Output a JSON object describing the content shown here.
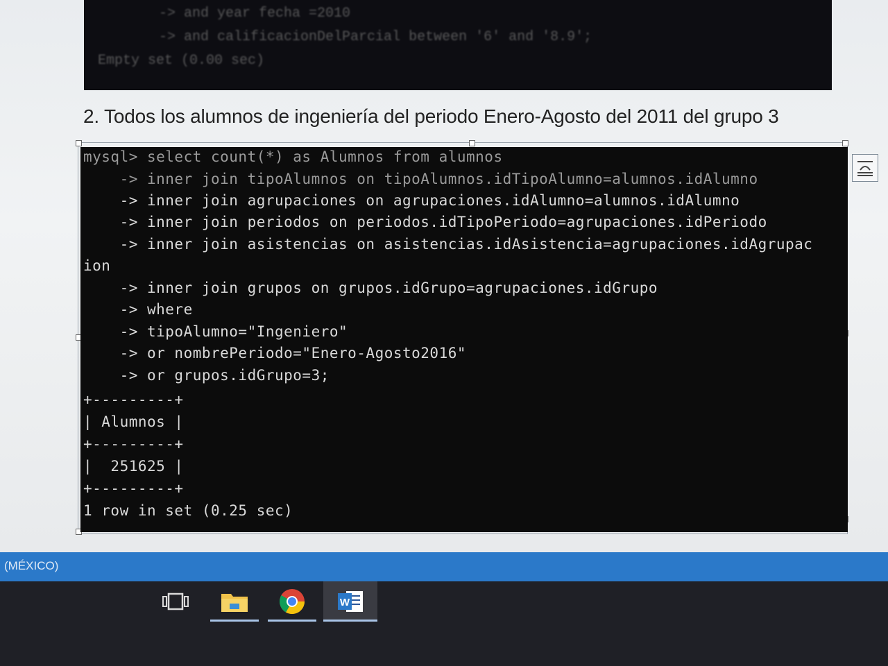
{
  "previous_terminal": {
    "lines": [
      "    -> and year fecha =2010",
      "    -> and calificacionDelParcial between '6' and '8.9';",
      "Empty set (0.00 sec)"
    ]
  },
  "heading": "2. Todos los alumnos de ingeniería del periodo Enero-Agosto del 2011 del grupo 3",
  "terminal": {
    "lines": [
      "mysql> select count(*) as Alumnos from alumnos",
      "    -> inner join tipoAlumnos on tipoAlumnos.idTipoAlumno=alumnos.idAlumno",
      "    -> inner join agrupaciones on agrupaciones.idAlumno=alumnos.idAlumno",
      "    -> inner join periodos on periodos.idTipoPeriodo=agrupaciones.idPeriodo",
      "    -> inner join asistencias on asistencias.idAsistencia=agrupaciones.idAgrupac",
      "ion",
      "    -> inner join grupos on grupos.idGrupo=agrupaciones.idGrupo",
      "    -> where",
      "    -> tipoAlumno=\"Ingeniero\"",
      "    -> or nombrePeriodo=\"Enero-Agosto2016\"",
      "    -> or grupos.idGrupo=3;",
      "+---------+",
      "| Alumnos |",
      "+---------+",
      "|  251625 |",
      "+---------+",
      "1 row in set (0.25 sec)"
    ]
  },
  "statusbar": {
    "language": "(MÉXICO)"
  },
  "taskbar": {
    "items": [
      {
        "icon": "task-view-icon"
      },
      {
        "icon": "file-explorer-icon"
      },
      {
        "icon": "chrome-icon"
      },
      {
        "icon": "word-icon",
        "active": true
      }
    ]
  },
  "colors": {
    "statusbar": "#2b79c9",
    "taskbar": "#1f2026",
    "terminal_bg": "#0c0c0c",
    "terminal_text": "#d9d9d9"
  }
}
